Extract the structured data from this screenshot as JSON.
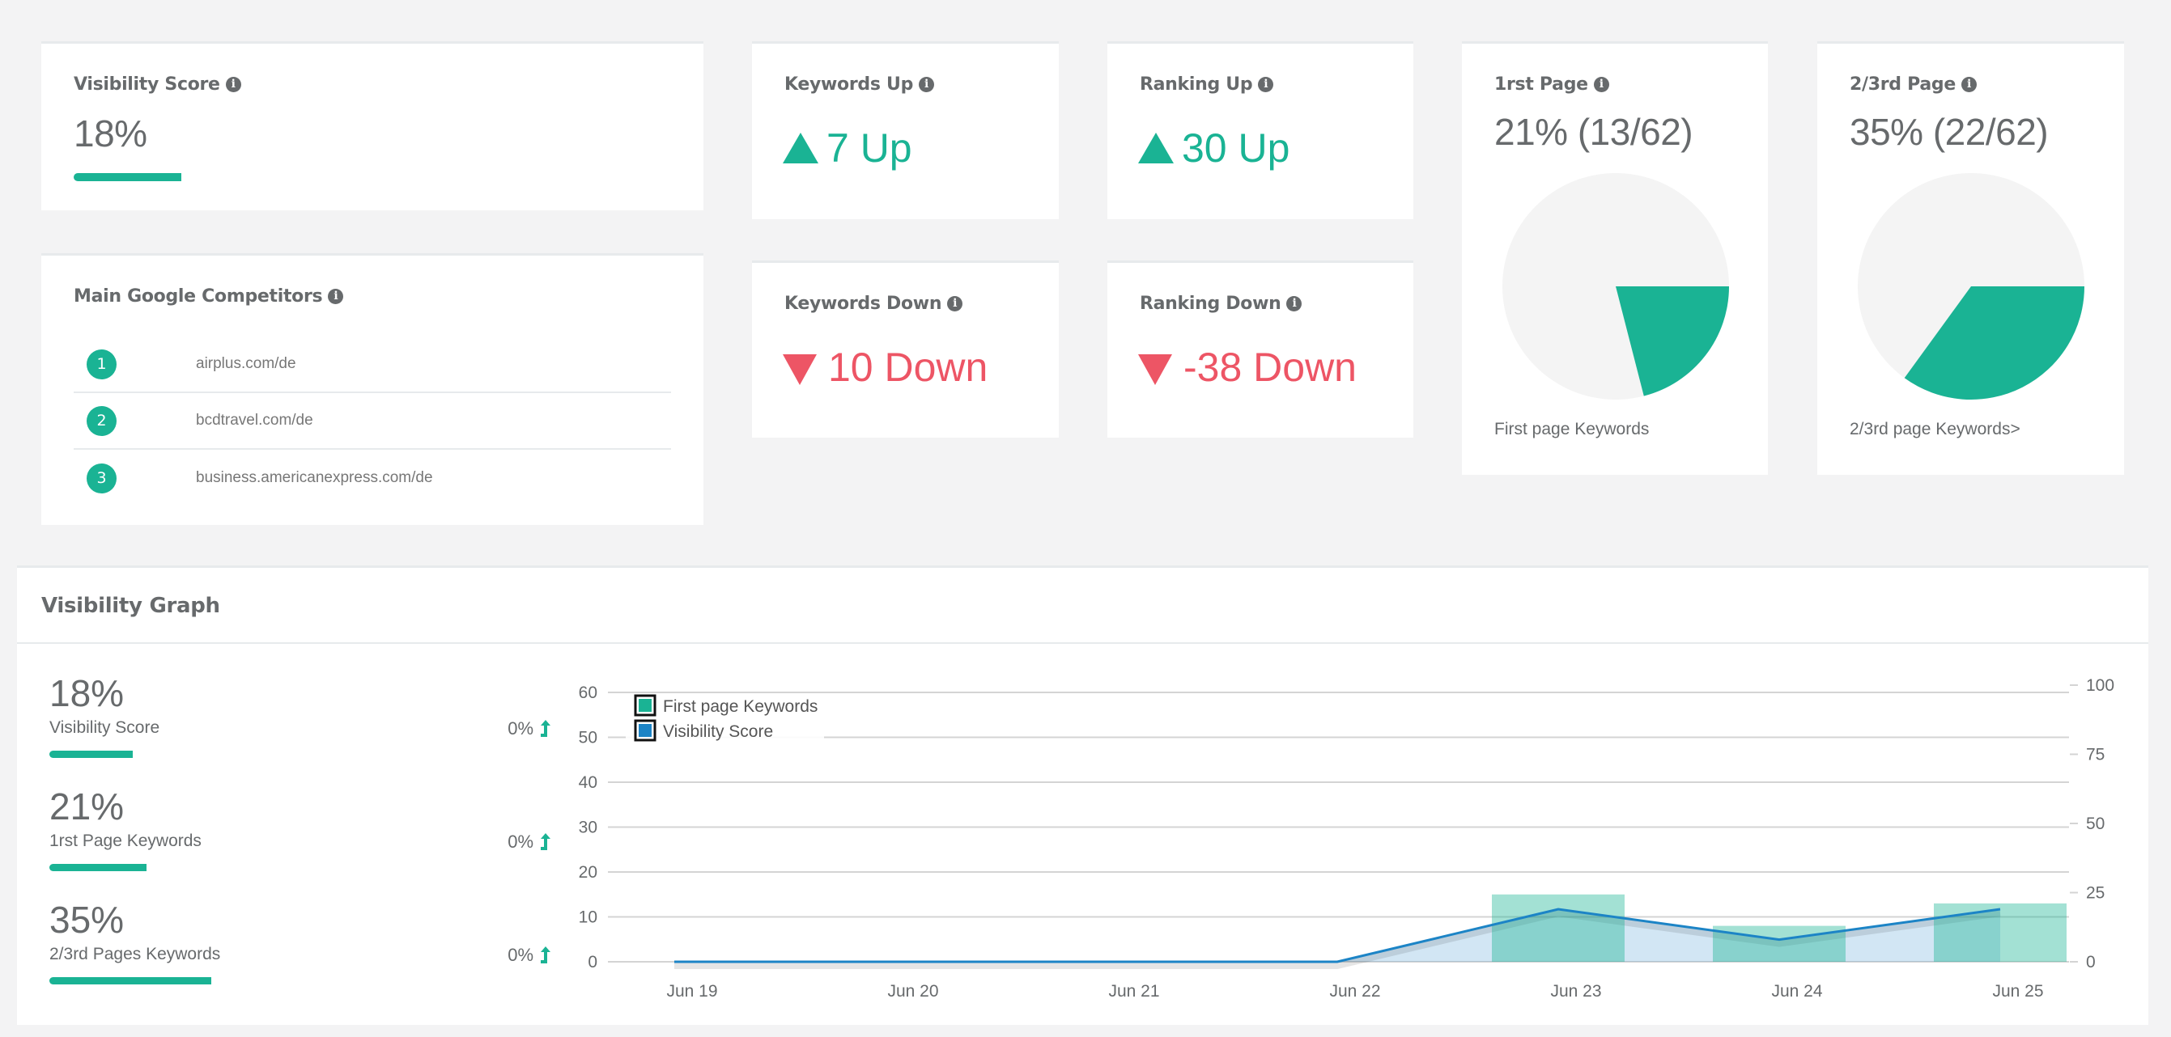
{
  "colors": {
    "accent": "#1ab394",
    "danger": "#ed5565",
    "text": "#676a6c",
    "line": "#1c84c6",
    "pie_empty": "#f4f4f4"
  },
  "visibility_card": {
    "title": "Visibility Score",
    "info_icon": "info-circle-icon",
    "value": "18%",
    "progress_percent": 18
  },
  "competitors_card": {
    "title": "Main Google Competitors",
    "info_icon": "info-circle-icon",
    "items": [
      {
        "rank": "1",
        "domain": "airplus.com/de"
      },
      {
        "rank": "2",
        "domain": "bcdtravel.com/de"
      },
      {
        "rank": "3",
        "domain": "business.americanexpress.com/de"
      }
    ]
  },
  "keywords_up": {
    "title": "Keywords Up",
    "icon": "triangle-up-icon",
    "value": "7 Up"
  },
  "keywords_down": {
    "title": "Keywords Down",
    "icon": "triangle-down-icon",
    "value": "10 Down"
  },
  "ranking_up": {
    "title": "Ranking Up",
    "icon": "triangle-up-icon",
    "value": "30 Up"
  },
  "ranking_down": {
    "title": "Ranking Down",
    "icon": "triangle-down-icon",
    "value": "-38 Down"
  },
  "first_page": {
    "title": "1rst Page",
    "value": "21% (13/62)",
    "percent": 21,
    "caption": "First page Keywords"
  },
  "second_third_page": {
    "title": "2/3rd Page",
    "value": "35% (22/62)",
    "percent": 35,
    "caption": "2/3rd page Keywords>"
  },
  "visibility_graph": {
    "title": "Visibility Graph",
    "stats": [
      {
        "value": "18%",
        "label": "Visibility Score",
        "change": "0%",
        "percent": 18,
        "icon": "level-up-icon"
      },
      {
        "value": "21%",
        "label": "1rst Page Keywords",
        "change": "0%",
        "percent": 21,
        "icon": "level-up-icon"
      },
      {
        "value": "35%",
        "label": "2/3rd Pages Keywords",
        "change": "0%",
        "percent": 35,
        "icon": "level-up-icon"
      }
    ]
  },
  "chart_data": {
    "type": "bar",
    "title": "",
    "categories": [
      "Jun 19",
      "Jun 20",
      "Jun 21",
      "Jun 22",
      "Jun 23",
      "Jun 24",
      "Jun 25"
    ],
    "series": [
      {
        "name": "First page Keywords",
        "kind": "bar",
        "axis": "left",
        "color": "#1ab394",
        "values": [
          0,
          0,
          0,
          0,
          15,
          8,
          13
        ]
      },
      {
        "name": "Visibility Score",
        "kind": "area-line",
        "axis": "right",
        "color": "#1c84c6",
        "values": [
          0,
          0,
          0,
          0,
          19,
          8,
          19
        ]
      }
    ],
    "y_left": {
      "min": 0,
      "max": 60,
      "ticks": [
        0,
        10,
        20,
        30,
        40,
        50,
        60
      ]
    },
    "y_right": {
      "min": 0,
      "max": 100,
      "ticks": [
        0,
        25,
        50,
        75,
        100
      ]
    },
    "xlabel": "",
    "ylabel": "",
    "grid": true,
    "legend": {
      "placement": "top-left",
      "entries": [
        "First page Keywords",
        "Visibility Score"
      ]
    }
  }
}
